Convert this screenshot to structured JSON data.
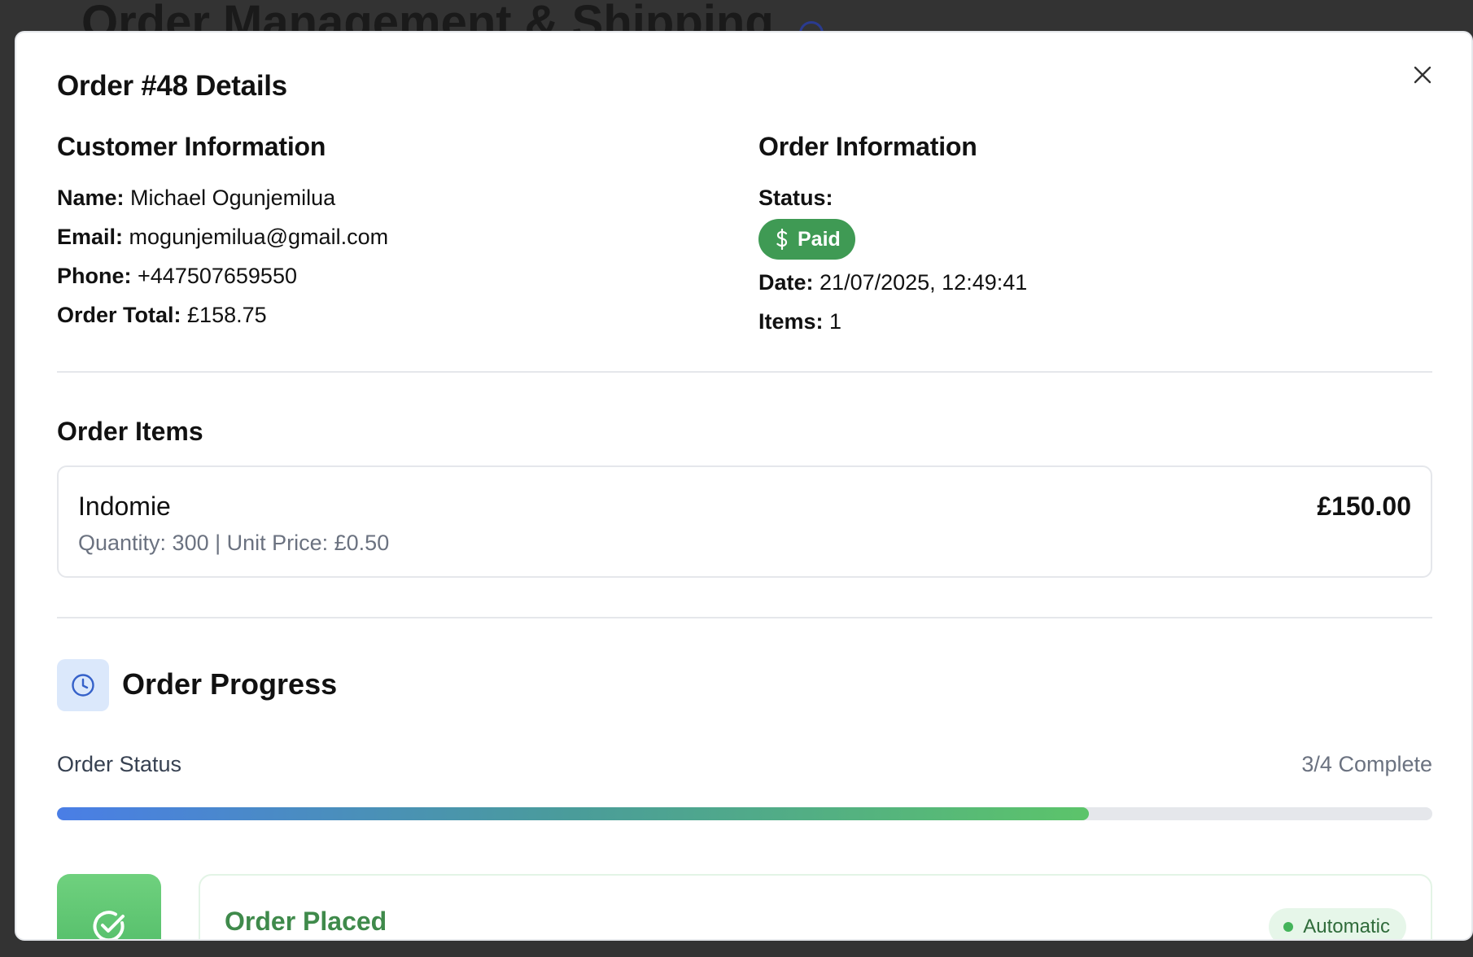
{
  "background": {
    "title": "Order Management & Shipping"
  },
  "modal": {
    "title": "Order #48 Details",
    "customer": {
      "heading": "Customer Information",
      "name_label": "Name:",
      "name": "Michael Ogunjemilua",
      "email_label": "Email:",
      "email": "mogunjemilua@gmail.com",
      "phone_label": "Phone:",
      "phone": "+447507659550",
      "total_label": "Order Total:",
      "total": "£158.75"
    },
    "order": {
      "heading": "Order Information",
      "status_label": "Status:",
      "status": "Paid",
      "status_icon": "dollar-icon",
      "status_color": "#3f9a54",
      "date_label": "Date:",
      "date": "21/07/2025, 12:49:41",
      "items_label": "Items:",
      "items": "1"
    },
    "order_items": {
      "heading": "Order Items",
      "list": [
        {
          "name": "Indomie",
          "details": "Quantity: 300 | Unit Price: £0.50",
          "price": "£150.00"
        }
      ]
    },
    "progress": {
      "heading": "Order Progress",
      "icon": "clock-icon",
      "status_label": "Order Status",
      "count_text": "3/4 Complete",
      "fraction": 0.75,
      "steps": [
        {
          "title": "Order Placed",
          "badge": "Automatic",
          "icon": "check-circle-icon"
        }
      ]
    }
  }
}
